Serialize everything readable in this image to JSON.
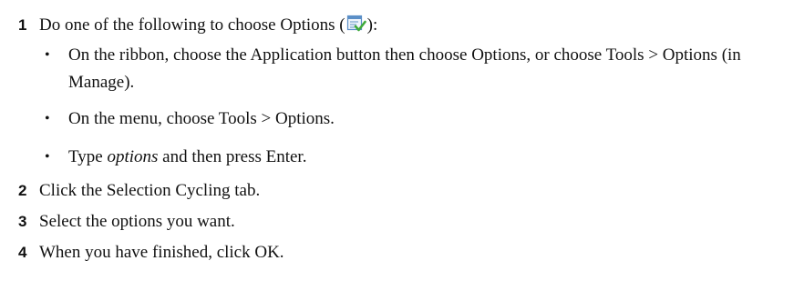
{
  "steps": [
    {
      "number": "1",
      "text_before": "Do one of the following to choose Options (",
      "icon": "options-icon",
      "text_after": "):"
    },
    {
      "number": "2",
      "text": "Click the Selection Cycling tab."
    },
    {
      "number": "3",
      "text": "Select the options you want."
    },
    {
      "number": "4",
      "text": "When you have finished, click OK."
    }
  ],
  "bullets": [
    {
      "symbol": "•",
      "text": "On the ribbon, choose the Application button then choose Options, or choose Tools > Options (in Manage)."
    },
    {
      "symbol": "•",
      "text": "On the menu, choose Tools > Options."
    },
    {
      "symbol": "•",
      "text_emphasis": "options",
      "text_after": " and then press Enter.",
      "text_before": "Type "
    }
  ],
  "colors": {
    "text": "#111111",
    "icon_window": "#5b8fc7",
    "icon_check": "#3faa3a"
  }
}
